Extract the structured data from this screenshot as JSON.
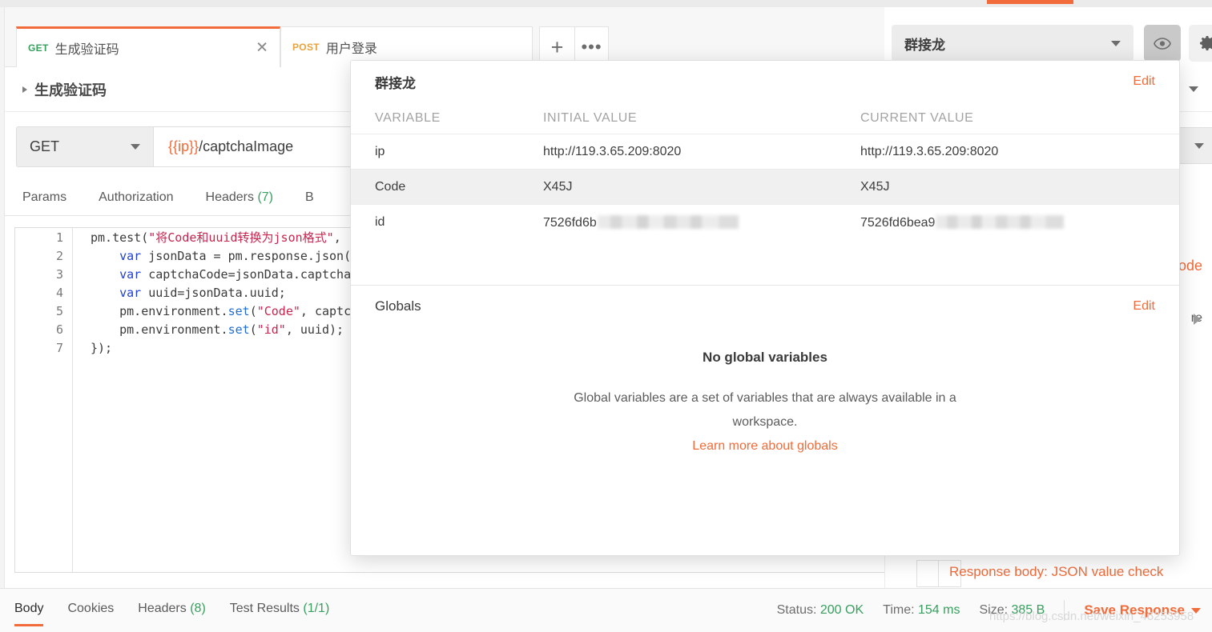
{
  "tabs": [
    {
      "method": "GET",
      "title": "生成验证码",
      "active": true,
      "close_label": "✕"
    },
    {
      "method": "POST",
      "title": "用户登录",
      "active": false,
      "close_label": ""
    }
  ],
  "tabbar": {
    "new_tab_label": "+",
    "more_label": "•••"
  },
  "request": {
    "title": "生成验证码",
    "method": "GET",
    "url_var": "{{ip}}",
    "url_path": "/captchaImage",
    "subtabs": [
      {
        "label": "Params",
        "count": ""
      },
      {
        "label": "Authorization",
        "count": ""
      },
      {
        "label": "Headers",
        "count": "(7)"
      },
      {
        "label": "B",
        "count": ""
      }
    ]
  },
  "editor": {
    "lines": [
      {
        "n": "1",
        "segments": [
          {
            "t": "pm.test(",
            "c": "plain"
          },
          {
            "t": "\"将Code和uuid转换为json格式\"",
            "c": "str"
          },
          {
            "t": ",",
            "c": "plain"
          }
        ]
      },
      {
        "n": "2",
        "segments": [
          {
            "t": "    ",
            "c": "plain"
          },
          {
            "t": "var",
            "c": "var"
          },
          {
            "t": " jsonData = pm.response.json(",
            "c": "plain"
          }
        ]
      },
      {
        "n": "3",
        "segments": [
          {
            "t": "    ",
            "c": "plain"
          },
          {
            "t": "var",
            "c": "var"
          },
          {
            "t": " captchaCode=jsonData.captcha",
            "c": "plain"
          }
        ]
      },
      {
        "n": "4",
        "segments": [
          {
            "t": "    ",
            "c": "plain"
          },
          {
            "t": "var",
            "c": "var"
          },
          {
            "t": " uuid=jsonData.uuid;",
            "c": "plain"
          }
        ]
      },
      {
        "n": "5",
        "segments": [
          {
            "t": "    pm.environment.",
            "c": "plain"
          },
          {
            "t": "set",
            "c": "fn"
          },
          {
            "t": "(",
            "c": "plain"
          },
          {
            "t": "\"Code\"",
            "c": "str"
          },
          {
            "t": ", captc",
            "c": "plain"
          }
        ]
      },
      {
        "n": "6",
        "segments": [
          {
            "t": "    pm.environment.",
            "c": "plain"
          },
          {
            "t": "set",
            "c": "fn"
          },
          {
            "t": "(",
            "c": "plain"
          },
          {
            "t": "\"id\"",
            "c": "str"
          },
          {
            "t": ", uuid);",
            "c": "plain"
          }
        ]
      },
      {
        "n": "7",
        "segments": [
          {
            "t": "});",
            "c": "plain"
          }
        ]
      }
    ]
  },
  "response": {
    "tabs": [
      {
        "label": "Body",
        "count": "",
        "active": true
      },
      {
        "label": "Cookies",
        "count": "",
        "active": false
      },
      {
        "label": "Headers",
        "count": "(8)",
        "active": false
      },
      {
        "label": "Test Results",
        "count": "(1/1)",
        "active": false
      }
    ],
    "status_label": "Status:",
    "status_value": "200 OK",
    "time_label": "Time:",
    "time_value": "154 ms",
    "size_label": "Size:",
    "size_value": "385 B",
    "save_label": "Save Response"
  },
  "environment": {
    "selected": "群接龙",
    "eye_icon": "eye-icon",
    "gear_icon": "gear-icon"
  },
  "modal": {
    "title": "群接龙",
    "edit_label": "Edit",
    "columns": [
      "VARIABLE",
      "INITIAL VALUE",
      "CURRENT VALUE"
    ],
    "rows": [
      {
        "variable": "ip",
        "initial": "http://119.3.65.209:8020",
        "current": "http://119.3.65.209:8020",
        "masked": false
      },
      {
        "variable": "Code",
        "initial": "X45J",
        "current": "X45J",
        "masked": false
      },
      {
        "variable": "id",
        "initial": "7526fd6b",
        "current": "7526fd6bea9",
        "masked": true
      }
    ],
    "globals": {
      "title": "Globals",
      "edit_label": "Edit",
      "empty_title": "No global variables",
      "empty_desc": "Global variables are a set of variables that are always available in a workspace.",
      "learn_link": "Learn more about globals"
    }
  },
  "right_rail": {
    "code_link": "Code",
    "more_text": "re",
    "test_name": "Response body: JSON value check"
  },
  "watermark": "https://blog.csdn.net/weixin_46253958",
  "colors": {
    "accent": "#f26b3a",
    "get_method": "#37a05e",
    "post_method": "#e8a33d",
    "success": "#37a05e"
  }
}
